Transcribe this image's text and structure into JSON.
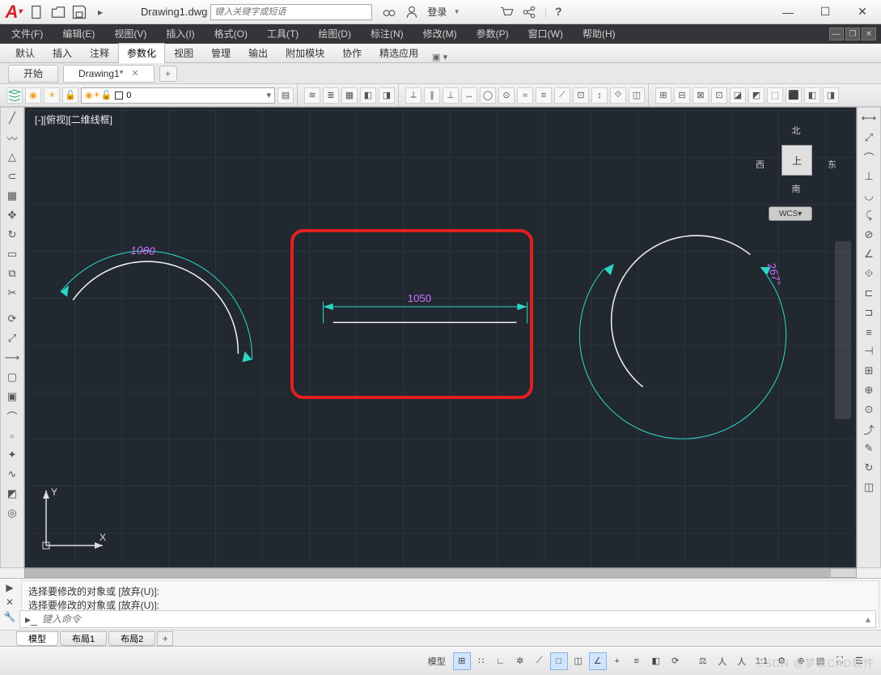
{
  "title": {
    "filename": "Drawing1.dwg",
    "search_placeholder": "键入关键字或短语",
    "login_label": "登录"
  },
  "menubar": {
    "items": [
      "文件(F)",
      "编辑(E)",
      "视图(V)",
      "插入(I)",
      "格式(O)",
      "工具(T)",
      "绘图(D)",
      "标注(N)",
      "修改(M)",
      "参数(P)",
      "窗口(W)",
      "帮助(H)"
    ]
  },
  "ribbon": {
    "tabs": [
      "默认",
      "插入",
      "注释",
      "参数化",
      "视图",
      "管理",
      "输出",
      "附加模块",
      "协作",
      "精选应用"
    ],
    "active_index": 3
  },
  "doctabs": {
    "tabs": [
      "开始",
      "Drawing1*"
    ],
    "active_index": 1
  },
  "layer": {
    "current": "0"
  },
  "viewport": {
    "label": "[-][俯视][二维线框]",
    "cube": {
      "n": "北",
      "s": "南",
      "e": "东",
      "w": "西",
      "face": "上",
      "wcs": "WCS"
    }
  },
  "drawing": {
    "arc_label_left": "1000",
    "dim_center": "1050",
    "arc_label_right": "267°"
  },
  "ucs": {
    "x": "X",
    "y": "Y"
  },
  "command": {
    "line1": "选择要修改的对象或 [放弃(U)]:",
    "line2": "选择要修改的对象或 [放弃(U)]:",
    "prompt_placeholder": "键入命令"
  },
  "layouttabs": {
    "tabs": [
      "模型",
      "布局1",
      "布局2"
    ],
    "active_index": 0
  },
  "status": {
    "model_label": "模型",
    "scale": "1:1"
  },
  "watermark": "CSDN @梦想CAD软件"
}
